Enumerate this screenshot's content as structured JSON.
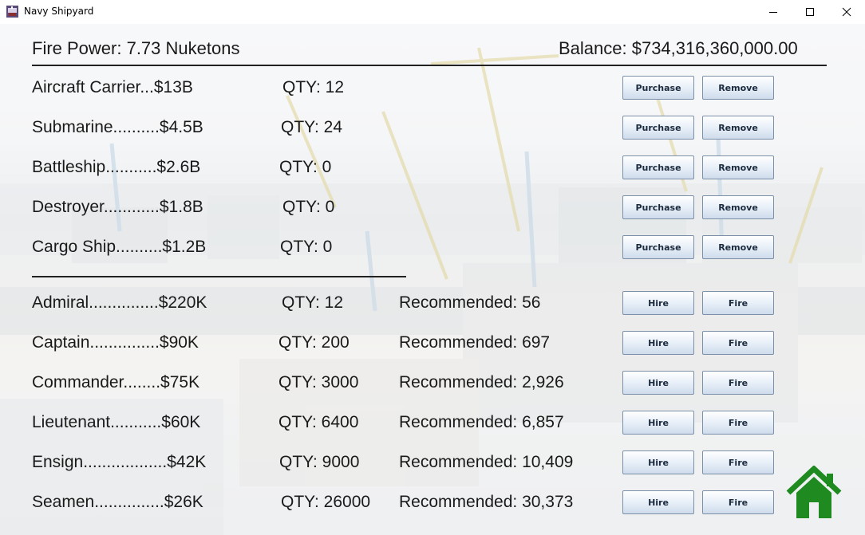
{
  "window": {
    "title": "Navy Shipyard"
  },
  "header": {
    "fire_power": "Fire Power: 7.73 Nuketons",
    "balance": "Balance: $734,316,360,000.00"
  },
  "ships": [
    {
      "label": "Aircraft Carrier...$13B",
      "qty": "QTY: 12",
      "buy": "Purchase",
      "remove": "Remove"
    },
    {
      "label": "Submarine..........$4.5B",
      "qty": "QTY: 24",
      "buy": "Purchase",
      "remove": "Remove"
    },
    {
      "label": "Battleship...........$2.6B",
      "qty": "QTY: 0",
      "buy": "Purchase",
      "remove": "Remove"
    },
    {
      "label": "Destroyer............$1.8B",
      "qty": "QTY: 0",
      "buy": "Purchase",
      "remove": "Remove"
    },
    {
      "label": "Cargo Ship..........$1.2B",
      "qty": "QTY: 0",
      "buy": "Purchase",
      "remove": "Remove"
    }
  ],
  "personnel": [
    {
      "label": "Admiral...............$220K",
      "qty": "QTY: 12",
      "recommended": "Recommended: 56",
      "hire": "Hire",
      "fire": "Fire"
    },
    {
      "label": "Captain...............$90K",
      "qty": "QTY: 200",
      "recommended": "Recommended: 697",
      "hire": "Hire",
      "fire": "Fire"
    },
    {
      "label": "Commander........$75K",
      "qty": "QTY: 3000",
      "recommended": "Recommended: 2,926",
      "hire": "Hire",
      "fire": "Fire"
    },
    {
      "label": "Lieutenant...........$60K",
      "qty": "QTY: 6400",
      "recommended": "Recommended: 6,857",
      "hire": "Hire",
      "fire": "Fire"
    },
    {
      "label": "Ensign..................$42K",
      "qty": "QTY: 9000",
      "recommended": "Recommended: 10,409",
      "hire": "Hire",
      "fire": "Fire"
    },
    {
      "label": "Seamen...............$26K",
      "qty": "QTY: 26000",
      "recommended": "Recommended: 30,373",
      "hire": "Hire",
      "fire": "Fire"
    }
  ],
  "icons": {
    "app": "ship-app-icon",
    "home": "home-icon",
    "minimize": "minimize-icon",
    "maximize": "maximize-icon",
    "close": "close-icon"
  },
  "colors": {
    "home_green": "#1f8a1f",
    "button_border": "#7b8fa8",
    "divider": "#222222"
  }
}
